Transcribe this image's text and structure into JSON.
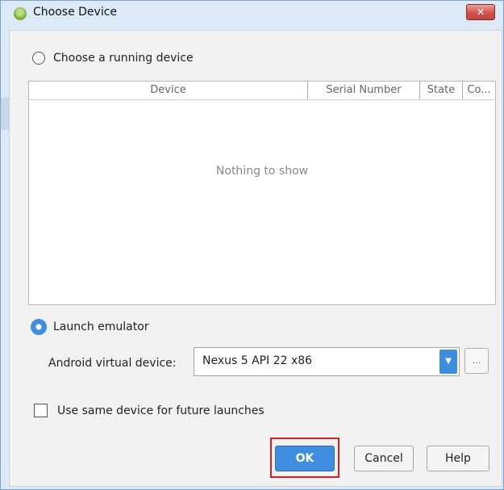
{
  "window": {
    "title": "Choose Device",
    "close_glyph": "✕",
    "icon": "android-studio-icon"
  },
  "running_device": {
    "label": "Choose a running device",
    "selected": false
  },
  "device_table": {
    "columns": [
      "Device",
      "Serial Number",
      "State",
      "Co..."
    ],
    "rows": [],
    "empty_text": "Nothing to show"
  },
  "launch_emulator": {
    "label": "Launch emulator",
    "selected": true
  },
  "avd": {
    "label": "Android virtual device:",
    "selected_value": "Nexus 5 API 22 x86",
    "arrow_glyph": "▼",
    "browse_glyph": "..."
  },
  "same_device": {
    "label": "Use same device for future launches",
    "checked": false
  },
  "buttons": {
    "ok": "OK",
    "cancel": "Cancel",
    "help": "Help"
  },
  "colors": {
    "accent": "#3e8ede",
    "highlight": "#d62020",
    "title_bar": "#dce9f6"
  }
}
